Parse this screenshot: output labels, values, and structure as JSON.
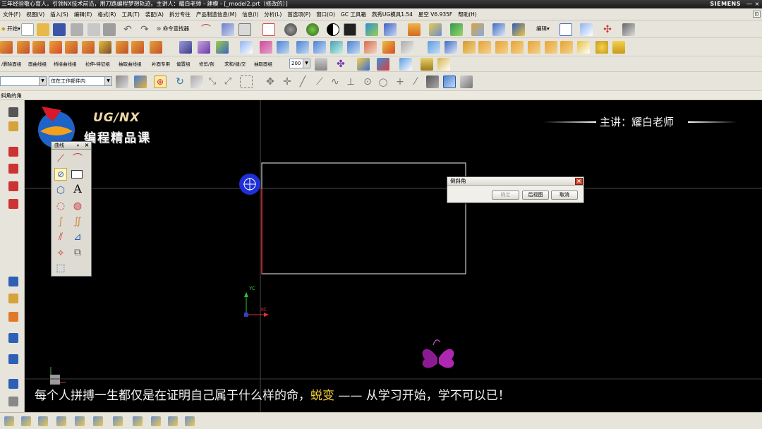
{
  "window": {
    "title": "三年经验敬心育人，引领NX技术前沿，用刀路编程梦想轨迹。主讲人：耀白老师 - 建模 - [_model2.prt（修改的）]",
    "brand": "SIEMENS",
    "minimize": "—",
    "close": "×"
  },
  "menu": {
    "items": [
      "文件(F)",
      "视图(V)",
      "插入(S)",
      "编辑(E)",
      "格式(R)",
      "工具(T)",
      "装配(A)",
      "拆分专往",
      "产品制造信息(M)",
      "信息(I)",
      "分析(L)",
      "首选项(P)",
      "窗口(O)",
      "GC 工具箱",
      "燕秀UG模具1.54",
      "星空 V6.935F",
      "帮助(H)"
    ],
    "restore": "⊡"
  },
  "toolbar1": {
    "start_label": "开始",
    "command_finder": "命令查找器",
    "edit_label": "编辑"
  },
  "toolbar3": {
    "items": [
      "/删除面组",
      "面曲线组",
      "桥接曲线组",
      "拉伸-特征组",
      "抽取曲线组",
      "补面专用",
      "偏置组",
      "修剪/剖",
      "求和/缝/交",
      "抽取面组"
    ],
    "zoom_value": "200"
  },
  "toolbar4": {
    "filter_value": "",
    "scope_value": "仅在工作部件内"
  },
  "function_strip": {
    "label": "斜角的角"
  },
  "viewport": {
    "logo_main": "UG/NX",
    "logo_sub": "编程精品课",
    "lecturer": "主讲：耀白老师",
    "subtitle_before": "每个人拼搏一生都仅是在证明自己属于什么样的命，",
    "subtitle_highlight": "蜕变",
    "subtitle_after": " —— 从学习开始，学不可以已！",
    "axis_y": "YC",
    "axis_x": "XC",
    "accent_blue": "#1f2fd6",
    "accent_pink": "#c12bc7"
  },
  "palette": {
    "title": "曲线",
    "dropdown": "▾",
    "close": "×",
    "text_tool": "A"
  },
  "dialog": {
    "title": "倒斜角",
    "ok": "确定",
    "back": "后视图",
    "cancel": "取消",
    "close": "×"
  }
}
